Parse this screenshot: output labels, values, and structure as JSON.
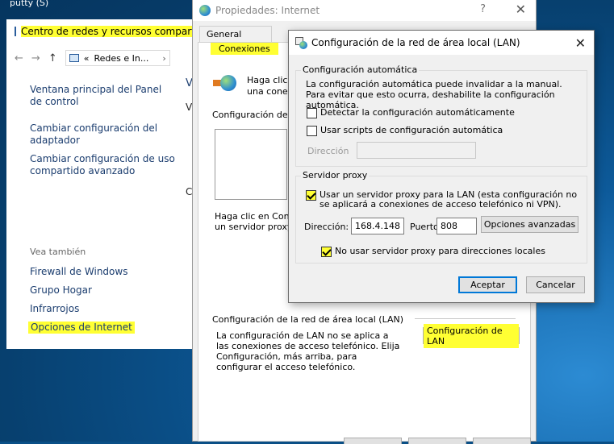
{
  "taskbar": {
    "app_label": "putty (S)"
  },
  "control_panel": {
    "title": "Centro de redes y recursos compartido",
    "address": "Redes e In...",
    "address_prefix": "«",
    "links": [
      "Ventana principal del Panel de control",
      "Cambiar configuración del adaptador",
      "Cambiar configuración de uso compartido avanzado"
    ],
    "see_also_label": "Vea también",
    "see_also_links": [
      "Firewall de Windows",
      "Grupo Hogar",
      "Infrarrojos",
      "Opciones de Internet"
    ],
    "peek_texts": [
      "V",
      "V",
      "C"
    ]
  },
  "internet_properties": {
    "title": "Propiedades: Internet",
    "help_glyph": "?",
    "tabs": [
      "General",
      "Conexiones"
    ],
    "setup_text": "Haga clic e... una conexi...",
    "setup_line1": "Haga clic e",
    "setup_line2": "una conexi",
    "dialup_header": "Configuración de ac",
    "proxy_hint_line1": "Haga clic en Config",
    "proxy_hint_line2": "un servidor proxy p",
    "lan_section_label": "Configuración de la red de área local (LAN)",
    "lan_note": "La configuración de LAN no se aplica a las conexiones de acceso telefónico. Elija Configuración, más arriba, para configurar el acceso telefónico.",
    "lan_button": "Configuración de LAN"
  },
  "lan_dialog": {
    "title": "Configuración de la red de área local (LAN)",
    "auto_group_label": "Configuración automática",
    "auto_note": "La configuración automática puede invalidar a la manual. Para evitar que esto ocurra, deshabilite la configuración automática.",
    "auto_detect_label": "Detectar la configuración automáticamente",
    "auto_script_label": "Usar scripts de configuración automática",
    "script_address_label": "Dirección",
    "script_address_value": "",
    "proxy_group_label": "Servidor proxy",
    "use_proxy_label": "Usar un servidor proxy para la LAN (esta configuración no se aplicará a conexiones de acceso telefónico ni VPN).",
    "address_label": "Dirección:",
    "address_value": "168.4.148",
    "port_label": "Puerto:",
    "port_value": "808",
    "advanced_button": "Opciones avanzadas",
    "bypass_label": "No usar servidor proxy para direcciones locales",
    "ok_button": "Aceptar",
    "cancel_button": "Cancelar",
    "checkbox_states": {
      "auto_detect": false,
      "auto_script": false,
      "use_proxy": true,
      "bypass": true
    }
  },
  "colors": {
    "highlight": "#ffff33",
    "link": "#1a3c6e",
    "accent": "#0078d7"
  }
}
